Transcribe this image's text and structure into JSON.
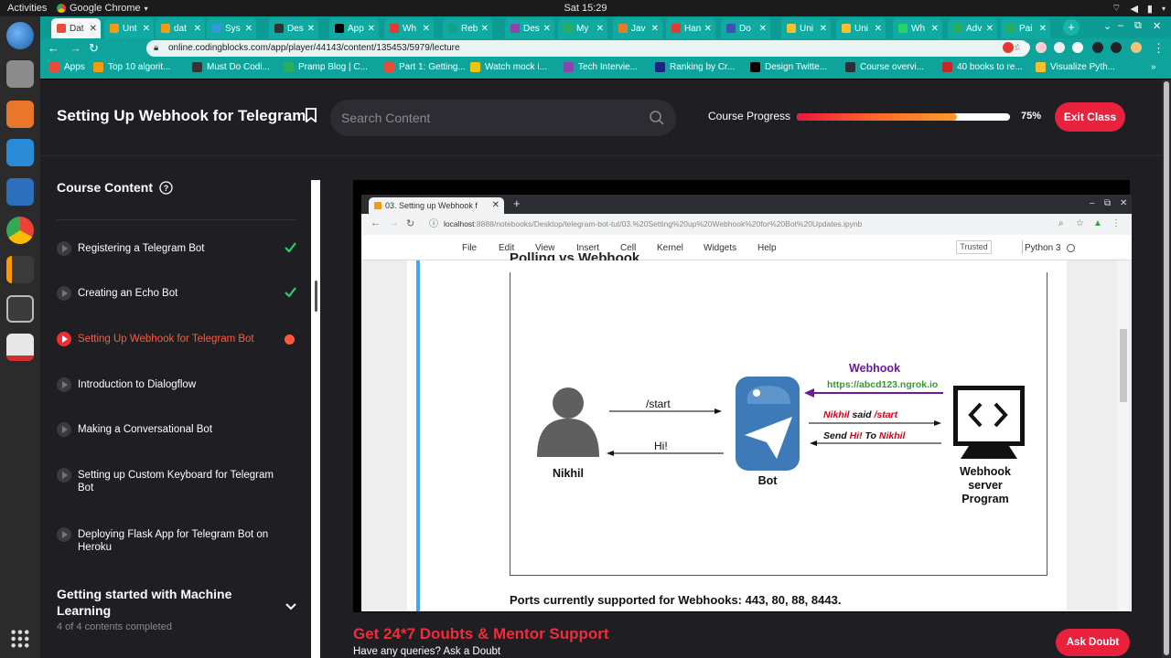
{
  "os": {
    "activities": "Activities",
    "app_name": "Google Chrome",
    "clock": "Sat 15:29"
  },
  "browser": {
    "tabs": [
      {
        "label": "Dat",
        "active": true,
        "color": "#e74c3c"
      },
      {
        "label": "Unt",
        "color": "#f39c12"
      },
      {
        "label": "dat",
        "color": "#f39c12"
      },
      {
        "label": "Sys",
        "color": "#3498db"
      },
      {
        "label": "Des",
        "color": "#333333"
      },
      {
        "label": "App",
        "color": "#000000"
      },
      {
        "label": "Wh",
        "color": "#e53935"
      },
      {
        "label": "Reb",
        "color": "#16a085"
      },
      {
        "label": "Des",
        "color": "#8e44ad"
      },
      {
        "label": "My",
        "color": "#27ae60"
      },
      {
        "label": "Jav",
        "color": "#e67e22"
      },
      {
        "label": "Han",
        "color": "#e53935"
      },
      {
        "label": "Do",
        "color": "#3f51b5"
      },
      {
        "label": "Uni",
        "color": "#fbc02d"
      },
      {
        "label": "Uni",
        "color": "#fbc02d"
      },
      {
        "label": "Wh",
        "color": "#25d366"
      },
      {
        "label": "Adv",
        "color": "#27ae60"
      },
      {
        "label": "Pai",
        "color": "#27ae60"
      }
    ],
    "url": "online.codingblocks.com/app/player/44143/content/135453/5979/lecture",
    "bookmarks": [
      {
        "label": "Apps",
        "color": "#e74c3c"
      },
      {
        "label": "Top 10 algorit...",
        "color": "#f39c12"
      },
      {
        "label": "Must Do Codi...",
        "color": "#333333"
      },
      {
        "label": "Pramp Blog | C...",
        "color": "#27ae60"
      },
      {
        "label": "Part 1: Getting...",
        "color": "#e74c3c"
      },
      {
        "label": "Watch mock i...",
        "color": "#f1c40f"
      },
      {
        "label": "Tech Intervie...",
        "color": "#8e44ad"
      },
      {
        "label": "Ranking by Cr...",
        "color": "#1a237e"
      },
      {
        "label": "Design Twitte...",
        "color": "#000000"
      },
      {
        "label": "Course overvi...",
        "color": "#263238"
      },
      {
        "label": "40 books to re...",
        "color": "#c62828"
      },
      {
        "label": "Visualize Pyth...",
        "color": "#fbc02d"
      }
    ]
  },
  "header": {
    "title": "Setting Up Webhook for Telegram",
    "search_placeholder": "Search Content",
    "progress_label": "Course Progress",
    "progress_value": 75,
    "progress_text": "75%",
    "exit_label": "Exit Class"
  },
  "sidebar": {
    "title": "Course Content",
    "lessons": [
      {
        "label": "Registering a Telegram Bot",
        "status": "done"
      },
      {
        "label": "Creating an Echo Bot",
        "status": "done"
      },
      {
        "label": "Setting Up Webhook for Telegram Bot",
        "status": "current"
      },
      {
        "label": "Introduction to Dialogflow",
        "status": "todo"
      },
      {
        "label": "Making a Conversational Bot",
        "status": "todo"
      },
      {
        "label": "Setting up Custom Keyboard for Telegram Bot",
        "status": "todo"
      },
      {
        "label": "Deploying Flask App for Telegram Bot on Heroku",
        "status": "todo"
      }
    ],
    "next_section": {
      "title": "Getting started with Machine Learning",
      "subtitle": "4 of 4 contents completed"
    }
  },
  "video": {
    "tab_title": "03. Setting up Webhook f",
    "url_host": "localhost",
    "url_rest": ":8888/notebooks/Desktop/telegram-bot-tut/03.%20Setting%20up%20Webhook%20for%20Bot%20Updates.ipynb",
    "menu": [
      "File",
      "Edit",
      "View",
      "Insert",
      "Cell",
      "Kernel",
      "Widgets",
      "Help"
    ],
    "trusted": "Trusted",
    "kernel": "Python 3",
    "cut_heading": "Polling vs Webhook",
    "diagram": {
      "user": "Nikhil",
      "bot": "Bot",
      "server": "Webhook server Program",
      "start_msg": "/start",
      "hi_msg": "Hi!",
      "webhook_title": "Webhook",
      "webhook_url": "https://abcd123.ngrok.io",
      "msg1": {
        "a": "Nikhil",
        "b": " said ",
        "c": "/start"
      },
      "msg2": {
        "a": "Send ",
        "b": "Hi!",
        "c": " To ",
        "d": "Nikhil"
      }
    },
    "ports_text": "Ports currently supported for Webhooks: 443, 80, 88, 8443."
  },
  "support": {
    "title": "Get 24*7 Doubts & Mentor Support",
    "subtitle": "Have any queries? Ask a Doubt",
    "button": "Ask Doubt"
  }
}
